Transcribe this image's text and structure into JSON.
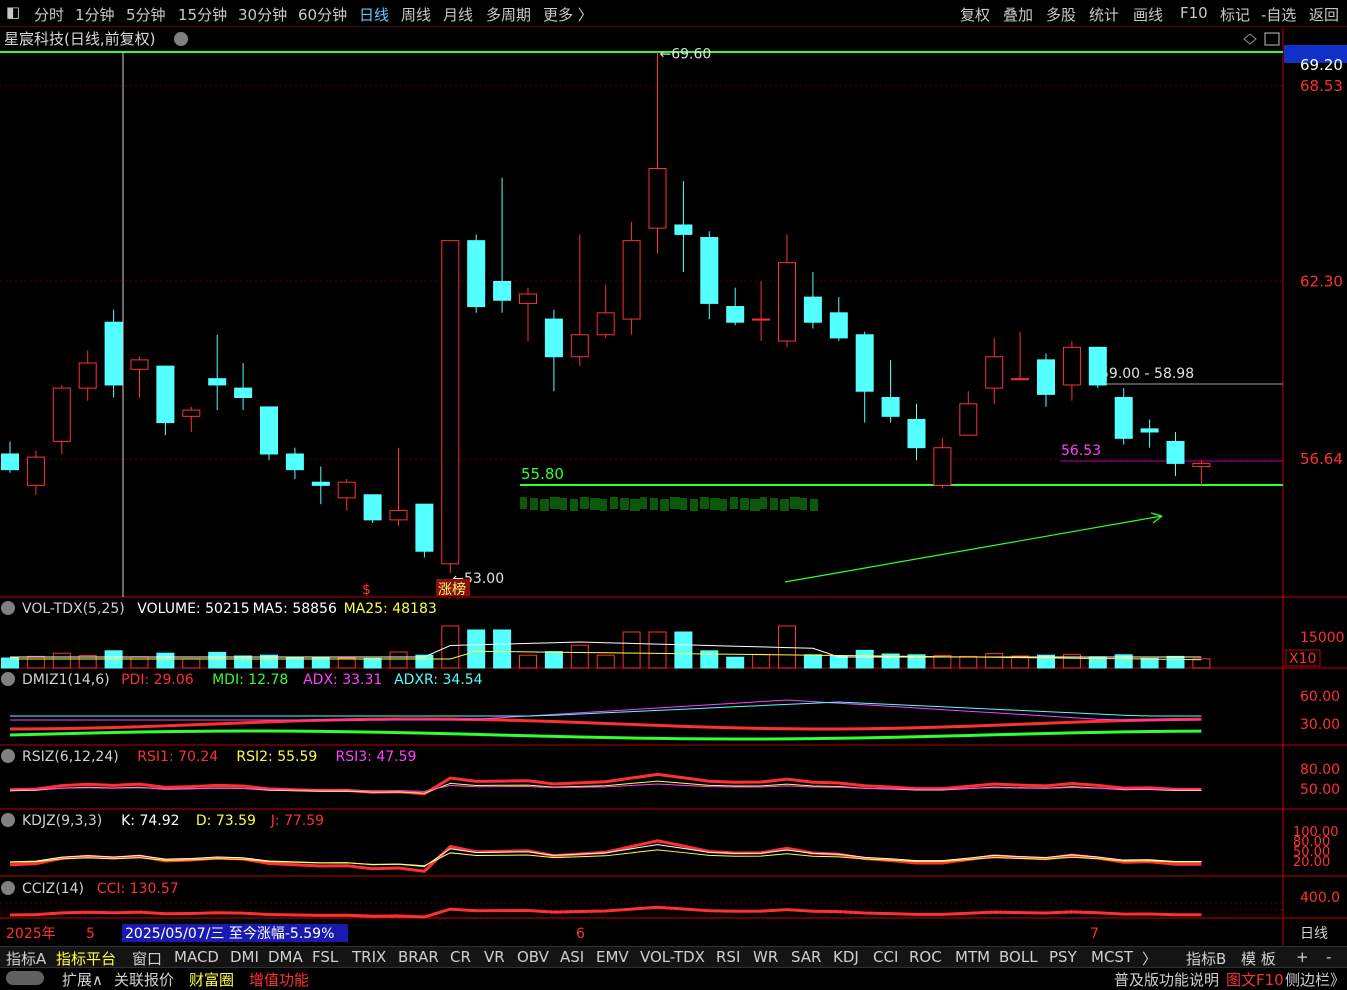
{
  "toolbar": {
    "periods": [
      "分时",
      "1分钟",
      "5分钟",
      "15分钟",
      "30分钟",
      "60分钟",
      "日线",
      "周线",
      "月线",
      "多周期",
      "更多 〉"
    ],
    "selected_period": "日线",
    "right_buttons": [
      "复权",
      "叠加",
      "多股",
      "统计",
      "画线",
      "F10",
      "标记",
      "-自选",
      "返回"
    ]
  },
  "stock": {
    "title": "星宸科技(日线,前复权)"
  },
  "colors": {
    "up": "#ff3030",
    "down": "#54ffff",
    "grid": "#5a0000",
    "axis": "#c00000"
  },
  "price_axis": [
    "69.20",
    "68.53",
    "62.30",
    "56.64"
  ],
  "annotations": {
    "high": "69.60",
    "low": "53.00",
    "limit_up_tag": "涨榜",
    "s_marker": "$",
    "support": "55.80",
    "level_range": "59.00 - 58.98",
    "level_last": "56.53"
  },
  "candles": [
    {
      "o": 56.8,
      "h": 57.2,
      "l": 56.2,
      "c": 56.3
    },
    {
      "o": 55.8,
      "h": 56.9,
      "l": 55.5,
      "c": 56.7
    },
    {
      "o": 57.2,
      "h": 59.0,
      "l": 56.8,
      "c": 58.9
    },
    {
      "o": 58.9,
      "h": 60.1,
      "l": 58.5,
      "c": 59.7
    },
    {
      "o": 61.0,
      "h": 61.4,
      "l": 58.6,
      "c": 59.0
    },
    {
      "o": 59.5,
      "h": 59.9,
      "l": 58.6,
      "c": 59.8
    },
    {
      "o": 59.6,
      "h": 59.6,
      "l": 57.4,
      "c": 57.8
    },
    {
      "o": 58.0,
      "h": 58.3,
      "l": 57.5,
      "c": 58.2
    },
    {
      "o": 59.2,
      "h": 60.6,
      "l": 58.2,
      "c": 59.0
    },
    {
      "o": 58.9,
      "h": 59.7,
      "l": 58.2,
      "c": 58.6
    },
    {
      "o": 58.3,
      "h": 58.3,
      "l": 56.6,
      "c": 56.8
    },
    {
      "o": 56.8,
      "h": 57.0,
      "l": 56.0,
      "c": 56.3
    },
    {
      "o": 55.9,
      "h": 56.4,
      "l": 55.2,
      "c": 55.8
    },
    {
      "o": 55.4,
      "h": 56.0,
      "l": 55.0,
      "c": 55.9
    },
    {
      "o": 55.5,
      "h": 55.5,
      "l": 54.6,
      "c": 54.7
    },
    {
      "o": 54.7,
      "h": 57.0,
      "l": 54.5,
      "c": 55.0
    },
    {
      "o": 55.2,
      "h": 55.2,
      "l": 53.5,
      "c": 53.7
    },
    {
      "o": 53.3,
      "h": 63.6,
      "l": 53.0,
      "c": 63.6
    },
    {
      "o": 63.6,
      "h": 63.8,
      "l": 61.3,
      "c": 61.5
    },
    {
      "o": 62.3,
      "h": 65.6,
      "l": 61.3,
      "c": 61.7
    },
    {
      "o": 61.6,
      "h": 62.1,
      "l": 60.4,
      "c": 61.9
    },
    {
      "o": 61.1,
      "h": 61.4,
      "l": 58.8,
      "c": 59.9
    },
    {
      "o": 59.9,
      "h": 63.8,
      "l": 59.6,
      "c": 60.6
    },
    {
      "o": 60.6,
      "h": 62.2,
      "l": 60.5,
      "c": 61.3
    },
    {
      "o": 61.1,
      "h": 64.2,
      "l": 60.6,
      "c": 63.6
    },
    {
      "o": 64.0,
      "h": 69.6,
      "l": 63.2,
      "c": 65.9
    },
    {
      "o": 64.1,
      "h": 65.5,
      "l": 62.6,
      "c": 63.8
    },
    {
      "o": 63.7,
      "h": 63.9,
      "l": 61.1,
      "c": 61.6
    },
    {
      "o": 61.5,
      "h": 62.1,
      "l": 60.9,
      "c": 61.0
    },
    {
      "o": 61.1,
      "h": 62.3,
      "l": 60.4,
      "c": 61.1
    },
    {
      "o": 60.4,
      "h": 63.8,
      "l": 60.2,
      "c": 62.9
    },
    {
      "o": 61.8,
      "h": 62.6,
      "l": 60.8,
      "c": 61.0
    },
    {
      "o": 61.3,
      "h": 61.8,
      "l": 60.4,
      "c": 60.5
    },
    {
      "o": 60.6,
      "h": 60.7,
      "l": 57.8,
      "c": 58.8
    },
    {
      "o": 58.6,
      "h": 59.8,
      "l": 57.8,
      "c": 58.0
    },
    {
      "o": 57.9,
      "h": 58.4,
      "l": 56.6,
      "c": 57.0
    },
    {
      "o": 55.8,
      "h": 57.3,
      "l": 55.7,
      "c": 57.0
    },
    {
      "o": 57.4,
      "h": 58.8,
      "l": 57.4,
      "c": 58.4
    },
    {
      "o": 58.9,
      "h": 60.5,
      "l": 58.4,
      "c": 59.9
    },
    {
      "o": 59.2,
      "h": 60.7,
      "l": 59.2,
      "c": 59.2
    },
    {
      "o": 59.8,
      "h": 60.0,
      "l": 58.3,
      "c": 58.7
    },
    {
      "o": 59.0,
      "h": 60.4,
      "l": 58.5,
      "c": 60.2
    },
    {
      "o": 60.2,
      "h": 60.2,
      "l": 58.9,
      "c": 59.0
    },
    {
      "o": 58.6,
      "h": 58.9,
      "l": 57.1,
      "c": 57.3
    },
    {
      "o": 57.6,
      "h": 57.9,
      "l": 57.0,
      "c": 57.5
    },
    {
      "o": 57.2,
      "h": 57.5,
      "l": 56.1,
      "c": 56.5
    },
    {
      "o": 56.4,
      "h": 56.6,
      "l": 55.8,
      "c": 56.5
    }
  ],
  "panels": {
    "vol": {
      "name": "VOL-TDX(5,25)",
      "vol_label": "VOLUME: 50215",
      "ma5": "MA5: 58856",
      "ma25": "MA25: 48183",
      "axis": "15000",
      "unit": "X10"
    },
    "dmi": {
      "name": "DMIZ1(14,6)",
      "pdi": "PDI: 29.06",
      "mdi": "MDI: 12.78",
      "adx": "ADX: 33.31",
      "adxr": "ADXR: 34.54",
      "axis": [
        "60.00",
        "30.00"
      ]
    },
    "rsi": {
      "name": "RSIZ(6,12,24)",
      "r1": "RSI1: 70.24",
      "r2": "RSI2: 55.59",
      "r3": "RSI3: 47.59",
      "axis": [
        "80.00",
        "50.00"
      ]
    },
    "kdj": {
      "name": "KDJZ(9,3,3)",
      "k": "K: 74.92",
      "d": "D: 73.59",
      "j": "J: 77.59",
      "axis": [
        "100.00",
        "80.00",
        "50.00",
        "20.00"
      ]
    },
    "cci": {
      "name": "CCIZ(14)",
      "cci": "CCI: 130.57",
      "axis": "400.0"
    }
  },
  "dates": {
    "year": "2025年",
    "m5": "5",
    "m6": "6",
    "m7": "7",
    "cursor": "2025/05/07/三  至今涨幅-5.59%",
    "period": "日线"
  },
  "indicator_tabs": [
    "指标A",
    "指标平台",
    "窗口",
    "MACD",
    "DMI",
    "DMA",
    "FSL",
    "TRIX",
    "BRAR",
    "CR",
    "VR",
    "OBV",
    "ASI",
    "EMV",
    "VOL-TDX",
    "RSI",
    "WR",
    "SAR",
    "KDJ",
    "CCI",
    "ROC",
    "MTM",
    "BOLL",
    "PSY",
    "MCST",
    "〉",
    "指标B",
    "模 板"
  ],
  "bottom_bar": [
    "扩展∧",
    "关联报价",
    "财富圈",
    "增值功能",
    "普及版功能说明",
    "图文F10",
    "侧边栏》"
  ]
}
